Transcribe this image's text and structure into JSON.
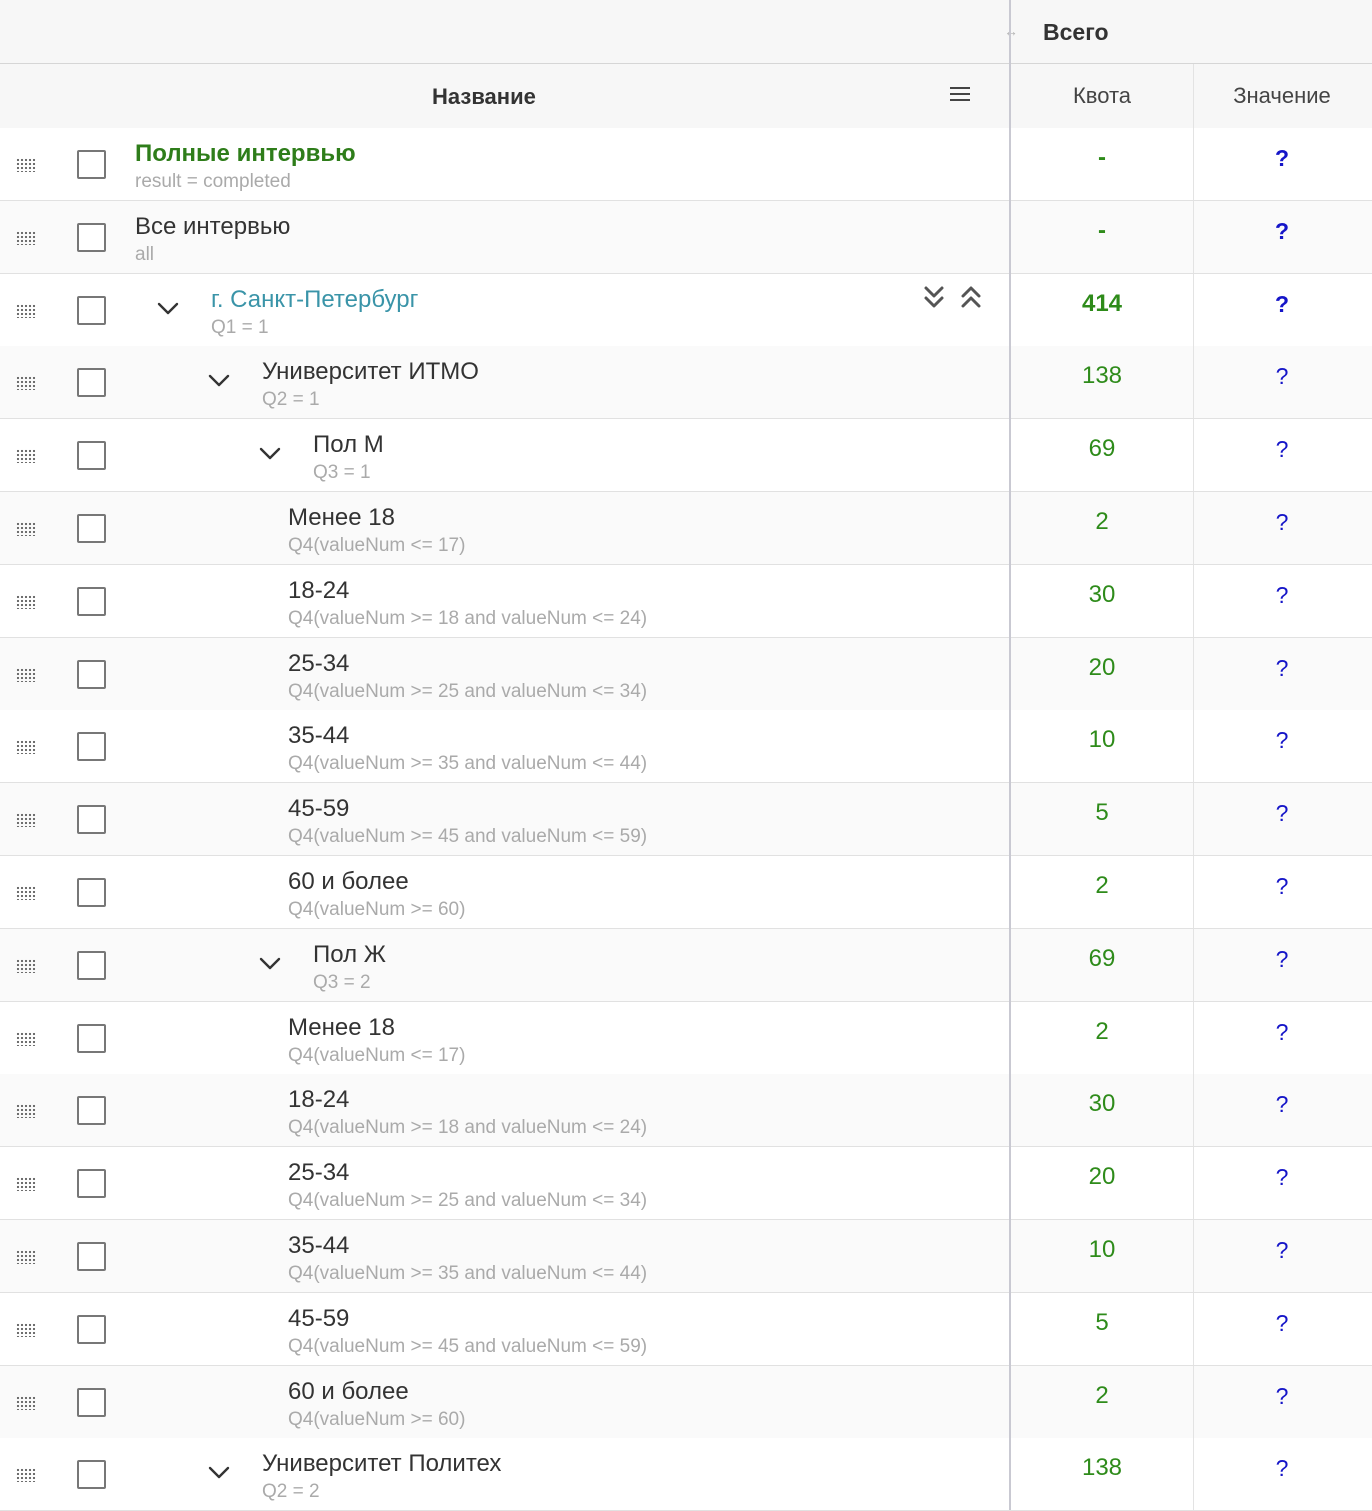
{
  "header": {
    "group_title": "Всего",
    "name_column": "Название",
    "quota_column": "Квота",
    "value_column": "Значение"
  },
  "rows": [
    {
      "title": "Полные интервью",
      "sub": "result = completed",
      "quota": "-",
      "value": "?",
      "style": "green",
      "level": 0,
      "expandable": false
    },
    {
      "title": "Все интервью",
      "sub": "all",
      "quota": "-",
      "value": "?",
      "style": "normal",
      "level": 0,
      "expandable": false
    },
    {
      "title": "г. Санкт-Петербург",
      "sub": "Q1 = 1",
      "quota": "414",
      "value": "?",
      "style": "teal",
      "level": 1,
      "expandable": true
    },
    {
      "title": "Университет ИТМО",
      "sub": "Q2 = 1",
      "quota": "138",
      "value": "?",
      "style": "normal",
      "level": 2,
      "expandable": true
    },
    {
      "title": "Пол М",
      "sub": "Q3 = 1",
      "quota": "69",
      "value": "?",
      "style": "normal",
      "level": 3,
      "expandable": true
    },
    {
      "title": "Менее 18",
      "sub": "Q4(valueNum <= 17)",
      "quota": "2",
      "value": "?",
      "style": "normal",
      "level": 4,
      "expandable": false
    },
    {
      "title": "18-24",
      "sub": "Q4(valueNum >= 18 and valueNum <= 24)",
      "quota": "30",
      "value": "?",
      "style": "normal",
      "level": 4,
      "expandable": false
    },
    {
      "title": "25-34",
      "sub": "Q4(valueNum >= 25 and valueNum <= 34)",
      "quota": "20",
      "value": "?",
      "style": "normal",
      "level": 4,
      "expandable": false
    },
    {
      "title": "35-44",
      "sub": "Q4(valueNum >= 35 and valueNum <= 44)",
      "quota": "10",
      "value": "?",
      "style": "normal",
      "level": 4,
      "expandable": false
    },
    {
      "title": "45-59",
      "sub": "Q4(valueNum >= 45 and valueNum <= 59)",
      "quota": "5",
      "value": "?",
      "style": "normal",
      "level": 4,
      "expandable": false
    },
    {
      "title": "60 и более",
      "sub": "Q4(valueNum >= 60)",
      "quota": "2",
      "value": "?",
      "style": "normal",
      "level": 4,
      "expandable": false
    },
    {
      "title": "Пол Ж",
      "sub": "Q3 = 2",
      "quota": "69",
      "value": "?",
      "style": "normal",
      "level": 3,
      "expandable": true
    },
    {
      "title": "Менее 18",
      "sub": "Q4(valueNum <= 17)",
      "quota": "2",
      "value": "?",
      "style": "normal",
      "level": 4,
      "expandable": false
    },
    {
      "title": "18-24",
      "sub": "Q4(valueNum >= 18 and valueNum <= 24)",
      "quota": "30",
      "value": "?",
      "style": "normal",
      "level": 4,
      "expandable": false
    },
    {
      "title": "25-34",
      "sub": "Q4(valueNum >= 25 and valueNum <= 34)",
      "quota": "20",
      "value": "?",
      "style": "normal",
      "level": 4,
      "expandable": false
    },
    {
      "title": "35-44",
      "sub": "Q4(valueNum >= 35 and valueNum <= 44)",
      "quota": "10",
      "value": "?",
      "style": "normal",
      "level": 4,
      "expandable": false
    },
    {
      "title": "45-59",
      "sub": "Q4(valueNum >= 45 and valueNum <= 59)",
      "quota": "5",
      "value": "?",
      "style": "normal",
      "level": 4,
      "expandable": false
    },
    {
      "title": "60 и более",
      "sub": "Q4(valueNum >= 60)",
      "quota": "2",
      "value": "?",
      "style": "normal",
      "level": 4,
      "expandable": false
    },
    {
      "title": "Университет Политех",
      "sub": "Q2 = 2",
      "quota": "138",
      "value": "?",
      "style": "normal",
      "level": 2,
      "expandable": true
    }
  ],
  "icons": {
    "drag_handle": "drag-handle-icon",
    "checkbox": "checkbox",
    "chevron": "chevron-down-icon",
    "expand_all": "double-chevron-down-icon",
    "collapse_all": "double-chevron-up-icon",
    "menu": "hamburger-menu-icon",
    "resize": "column-resize-icon"
  },
  "colors": {
    "quota_green": "#2e8b1a",
    "title_green": "#2e7d1a",
    "link_teal": "#3a94a8",
    "value_blue": "#1515c8"
  }
}
